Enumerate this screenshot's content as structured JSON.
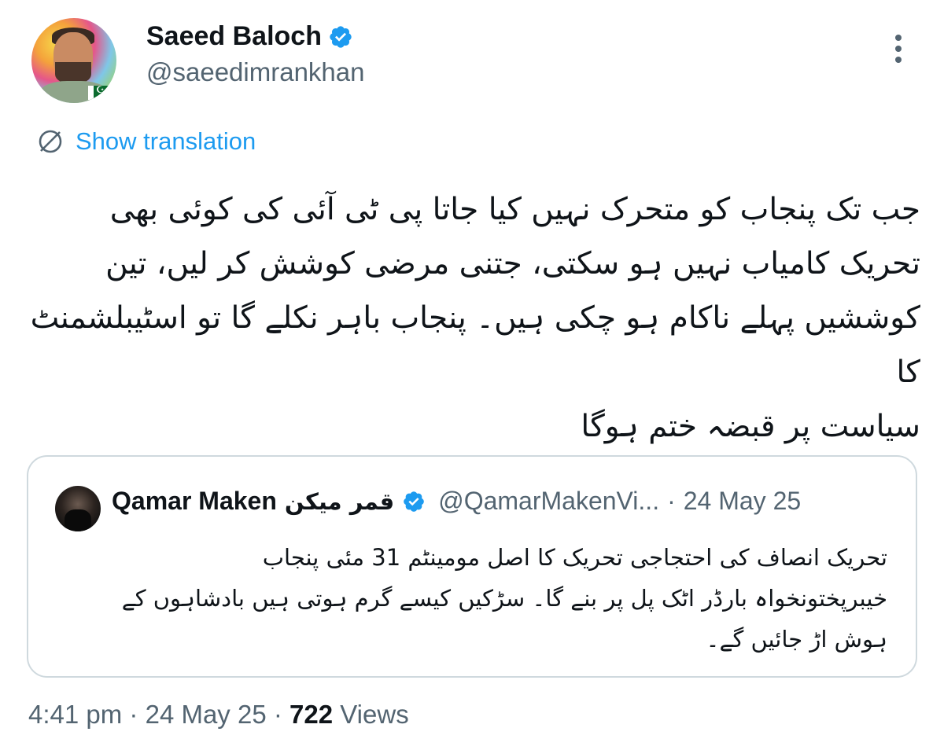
{
  "author": {
    "name": "Saeed Baloch",
    "handle": "@saeedimrankhan",
    "verified": true
  },
  "translation": {
    "label": "Show translation"
  },
  "tweet": {
    "lines": [
      "جب تک پنجاب کو متحرک نہیں کیا جاتا پی ٹی آئی کی کوئی بھی",
      "تحریک کامیاب نہیں ہو سکتی، جتنی مرضی کوشش کر لیں، تین",
      "کوششیں پہلے ناکام ہو چکی ہیں۔ پنجاب باہر نکلے گا تو اسٹیبلشمنٹ کا",
      "سیاست پر قبضہ ختم ہوگا"
    ]
  },
  "quoted_tweet": {
    "name": "Qamar Maken",
    "name_urdu": "قمر میکن",
    "handle": "@QamarMakenVi...",
    "separator": "·",
    "date": "24 May 25",
    "lines": [
      "تحریک انصاف کی احتجاجی تحریک کا اصل مومینٹم 31 مئی پنجاب",
      "خیبرپختونخواہ بارڈر اٹک پل پر بنے گا۔ سڑکیں کیسے گرم ہوتی ہیں بادشاہوں کے",
      "ہوش اڑ جائیں گے۔"
    ]
  },
  "meta": {
    "time": "4:41 pm",
    "separator": "·",
    "date": "24 May 25",
    "views_count": "722",
    "views_label": "Views"
  },
  "colors": {
    "accent": "#1d9bf0",
    "secondary_text": "#536471",
    "primary_text": "#0f1419",
    "border": "#cfd9de"
  },
  "icons": {
    "verified": "verified-badge-icon",
    "translate": "translate-globe-icon",
    "more": "more-vertical-icon"
  }
}
